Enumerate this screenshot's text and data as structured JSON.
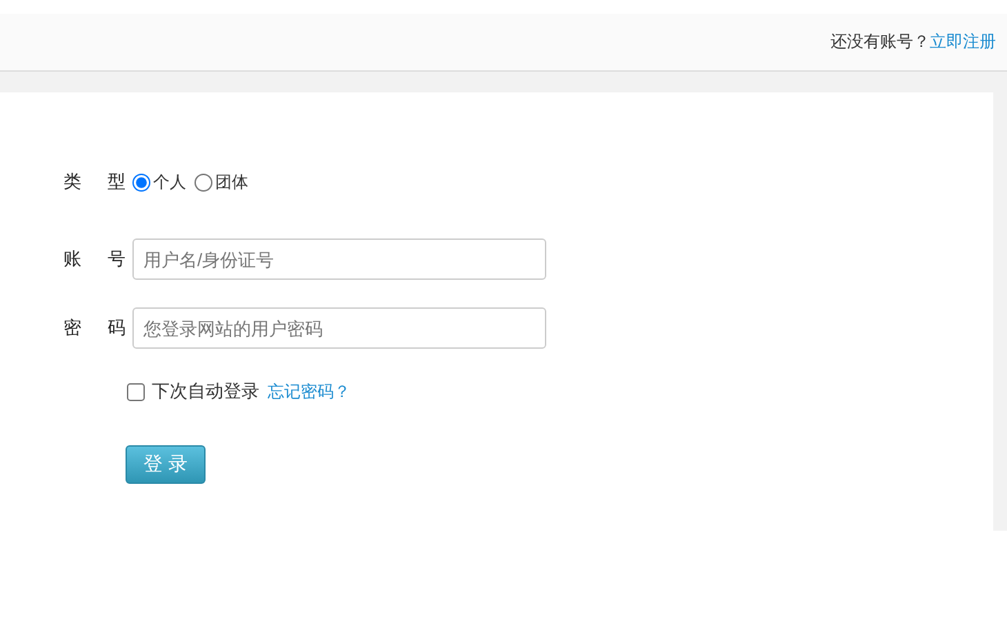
{
  "header": {
    "prompt": "还没有账号？",
    "register_link": "立即注册"
  },
  "type_field": {
    "label": "类 型",
    "options": [
      {
        "label": "个人",
        "selected": true
      },
      {
        "label": "团体",
        "selected": false
      }
    ]
  },
  "account_field": {
    "label": "账 号",
    "placeholder": "用户名/身份证号"
  },
  "password_field": {
    "label": "密 码",
    "placeholder": "您登录网站的用户密码"
  },
  "remember": {
    "label": "下次自动登录",
    "checked": false
  },
  "forgot_link": "忘记密码？",
  "login_button": "登 录"
}
